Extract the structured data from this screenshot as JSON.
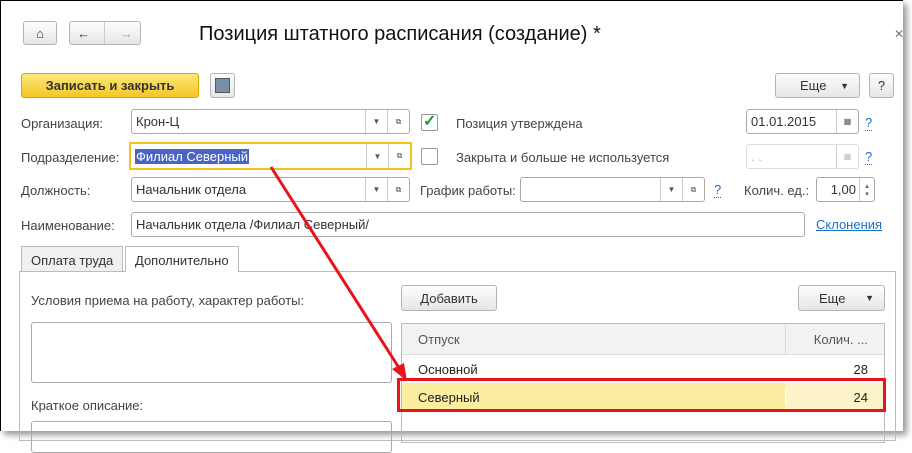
{
  "title": "Позиция штатного расписания (создание) *",
  "toolbar": {
    "save_close": "Записать и закрыть",
    "more": "Еще",
    "help": "?"
  },
  "fields": {
    "org_label": "Организация:",
    "org_value": "Крон-Ц",
    "dept_label": "Подразделение:",
    "dept_value": "Филиал Северный",
    "position_label": "Должность:",
    "position_value": "Начальник отдела",
    "name_label": "Наименование:",
    "name_value": "Начальник отдела /Филиал Северный/",
    "approved_label": "Позиция утверждена",
    "approved_date": "01.01.2015",
    "closed_label": "Закрыта и больше не используется",
    "closed_date": " .  .",
    "schedule_label": "График работы:",
    "schedule_value": "",
    "qty_label": "Колич. ед.:",
    "qty_value": "1,00",
    "help": "?",
    "declensions": "Склонения"
  },
  "tabs": [
    {
      "label": "Оплата труда"
    },
    {
      "label": "Дополнительно"
    }
  ],
  "panel": {
    "conditions_label": "Условия приема на работу, характер работы:",
    "brief_label": "Краткое описание:",
    "add": "Добавить",
    "more": "Еще",
    "columns": [
      "Отпуск",
      "Колич. ..."
    ],
    "rows": [
      {
        "name": "Основной",
        "qty": "28"
      },
      {
        "name": "Северный",
        "qty": "24"
      }
    ]
  }
}
